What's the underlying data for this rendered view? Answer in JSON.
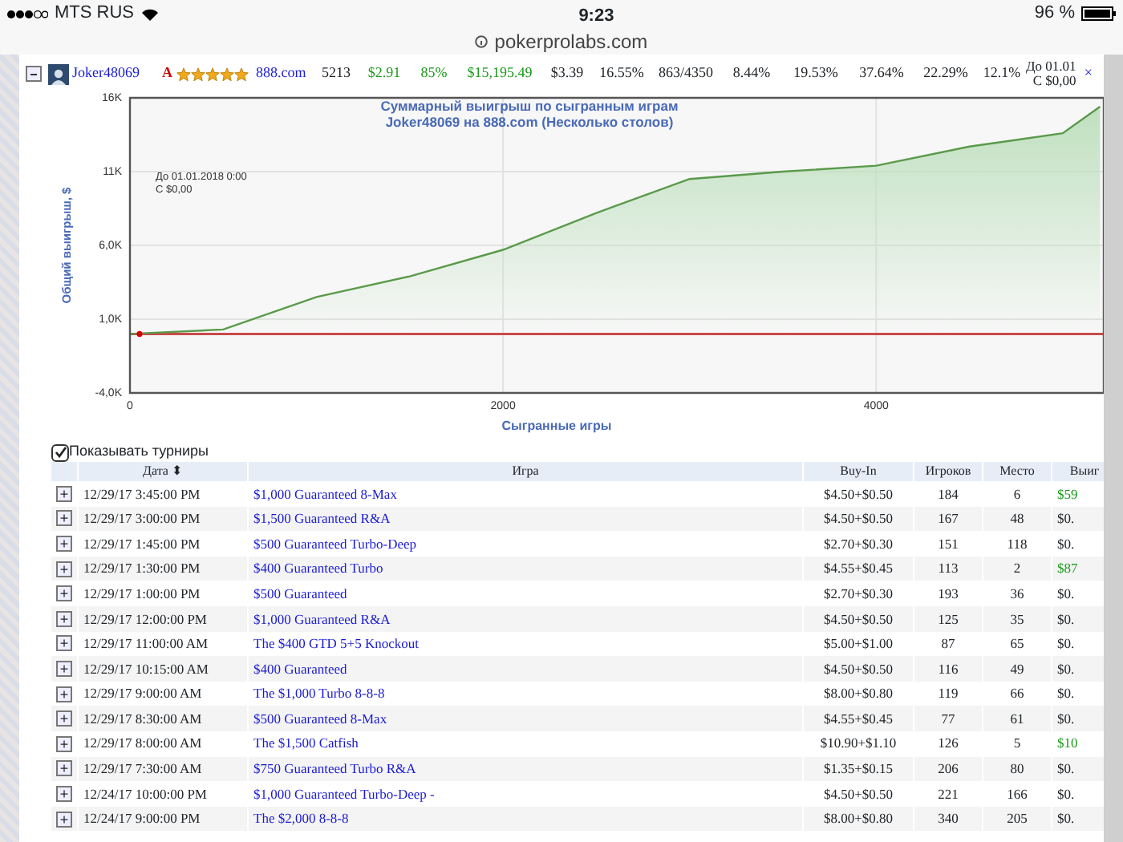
{
  "status_bar": {
    "carrier": "MTS RUS",
    "time": "9:23",
    "battery": "96 %",
    "url": "pokerprolabs.com"
  },
  "player_row": {
    "expanded": true,
    "name": "Joker48069",
    "rank": "A",
    "stars": 5,
    "site": "888.com",
    "cells": [
      {
        "text": "5213",
        "kind": "plain"
      },
      {
        "text": "$2.91",
        "kind": "positive"
      },
      {
        "text": "85%",
        "kind": "positive"
      },
      {
        "text": "$15,195.49",
        "kind": "positive"
      },
      {
        "text": "$3.39",
        "kind": "plain"
      },
      {
        "text": "16.55%",
        "kind": "plain"
      },
      {
        "text": "863/4350",
        "kind": "plain"
      },
      {
        "text": "8.44%",
        "kind": "plain"
      },
      {
        "text": "19.53%",
        "kind": "plain"
      },
      {
        "text": "37.64%",
        "kind": "plain"
      },
      {
        "text": "22.29%",
        "kind": "plain"
      },
      {
        "text": "12.1%",
        "kind": "plain"
      }
    ],
    "period": [
      "До 01.01",
      "С $0,00"
    ],
    "close": "×"
  },
  "chart": {
    "note": [
      "До 01.01.2018 0:00",
      "С $0,00"
    ],
    "chart_data": {
      "type": "area",
      "title": "Суммарный выигрыш по сыгранным играм Joker48069 на 888.com (Несколько столов)",
      "xlabel": "Сыгранные игры",
      "ylabel": "Общий выигрыш, $",
      "x": [
        0,
        500,
        1000,
        1500,
        2000,
        2500,
        3000,
        3500,
        4000,
        4500,
        5000,
        5200
      ],
      "series": [
        {
          "color": "#5a9a4a",
          "values": [
            0,
            300,
            2500,
            3900,
            5700,
            8200,
            10500,
            11000,
            11400,
            12700,
            13600,
            15400
          ]
        }
      ],
      "ref_lines": [
        {
          "axis": "y",
          "value": 0,
          "color": "#c84a4a"
        }
      ],
      "grid": true,
      "xlim": [
        0,
        5220
      ],
      "ylim": [
        -4000,
        16000
      ],
      "xticks": [
        0,
        2000,
        4000
      ],
      "yticks": [
        {
          "value": -4000,
          "label": "-4,0K"
        },
        {
          "value": 1000,
          "label": "1,0K"
        },
        {
          "value": 6000,
          "label": "6,0K"
        },
        {
          "value": 11000,
          "label": "11K"
        },
        {
          "value": 16000,
          "label": "16K"
        }
      ]
    }
  },
  "show_tournaments": {
    "label": "Показывать турниры",
    "checked": true
  },
  "table": {
    "columns": [
      "Дата",
      "Игра",
      "Buy-In",
      "Игроков",
      "Место",
      "Выиг"
    ],
    "sort_icon": "⬍",
    "toggle": "+",
    "rows": [
      {
        "date": "12/29/17 3:45:00 PM",
        "game": "$1,000 Guaranteed 8-Max",
        "buyin": "$4.50+$0.50",
        "players": "184",
        "place": "6",
        "win": "$59",
        "won": true
      },
      {
        "date": "12/29/17 3:00:00 PM",
        "game": "$1,500 Guaranteed R&A",
        "buyin": "$4.50+$0.50",
        "players": "167",
        "place": "48",
        "win": "$0.",
        "won": false
      },
      {
        "date": "12/29/17 1:45:00 PM",
        "game": "$500 Guaranteed Turbo-Deep",
        "buyin": "$2.70+$0.30",
        "players": "151",
        "place": "118",
        "win": "$0.",
        "won": false
      },
      {
        "date": "12/29/17 1:30:00 PM",
        "game": "$400 Guaranteed Turbo",
        "buyin": "$4.55+$0.45",
        "players": "113",
        "place": "2",
        "win": "$87",
        "won": true
      },
      {
        "date": "12/29/17 1:00:00 PM",
        "game": "$500 Guaranteed",
        "buyin": "$2.70+$0.30",
        "players": "193",
        "place": "36",
        "win": "$0.",
        "won": false
      },
      {
        "date": "12/29/17 12:00:00 PM",
        "game": "$1,000 Guaranteed R&A",
        "buyin": "$4.50+$0.50",
        "players": "125",
        "place": "35",
        "win": "$0.",
        "won": false
      },
      {
        "date": "12/29/17 11:00:00 AM",
        "game": "The $400 GTD 5+5 Knockout",
        "buyin": "$5.00+$1.00",
        "players": "87",
        "place": "65",
        "win": "$0.",
        "won": false
      },
      {
        "date": "12/29/17 10:15:00 AM",
        "game": "$400 Guaranteed",
        "buyin": "$4.50+$0.50",
        "players": "116",
        "place": "49",
        "win": "$0.",
        "won": false
      },
      {
        "date": "12/29/17 9:00:00 AM",
        "game": "The $1,000 Turbo 8-8-8",
        "buyin": "$8.00+$0.80",
        "players": "119",
        "place": "66",
        "win": "$0.",
        "won": false
      },
      {
        "date": "12/29/17 8:30:00 AM",
        "game": "$500 Guaranteed 8-Max",
        "buyin": "$4.55+$0.45",
        "players": "77",
        "place": "61",
        "win": "$0.",
        "won": false
      },
      {
        "date": "12/29/17 8:00:00 AM",
        "game": "The $1,500 Catfish",
        "buyin": "$10.90+$1.10",
        "players": "126",
        "place": "5",
        "win": "$10",
        "won": true
      },
      {
        "date": "12/29/17 7:30:00 AM",
        "game": "$750 Guaranteed Turbo R&A",
        "buyin": "$1.35+$0.15",
        "players": "206",
        "place": "80",
        "win": "$0.",
        "won": false
      },
      {
        "date": "12/24/17 10:00:00 PM",
        "game": "$1,000 Guaranteed Turbo-Deep -",
        "buyin": "$4.50+$0.50",
        "players": "221",
        "place": "166",
        "win": "$0.",
        "won": false
      },
      {
        "date": "12/24/17 9:00:00 PM",
        "game": "The $2,000 8-8-8",
        "buyin": "$8.00+$0.80",
        "players": "340",
        "place": "205",
        "win": "$0.",
        "won": false
      }
    ]
  }
}
